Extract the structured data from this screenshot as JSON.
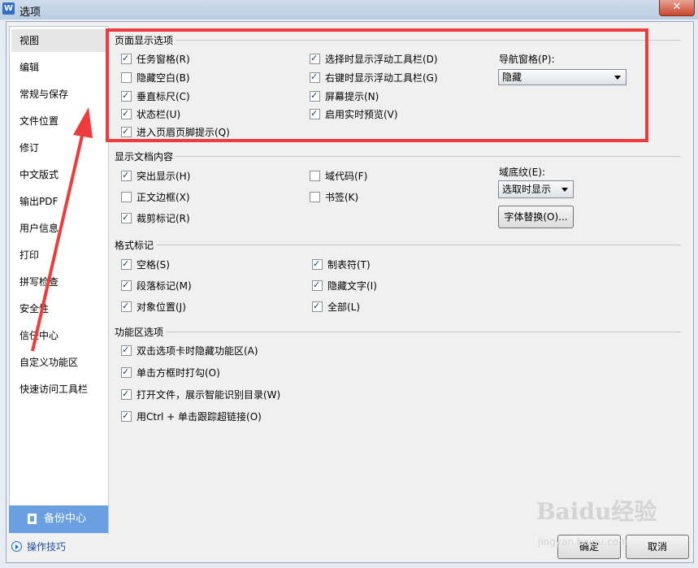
{
  "window": {
    "title": "选项",
    "app_icon": "W",
    "close_label": "✕"
  },
  "sidebar": {
    "items": [
      "视图",
      "编辑",
      "常规与保存",
      "文件位置",
      "修订",
      "中文版式",
      "输出PDF",
      "用户信息",
      "打印",
      "拼写检查",
      "安全性",
      "信任中心",
      "自定义功能区",
      "快速访问工具栏"
    ],
    "active_index": 0,
    "backup_label": "备份中心",
    "tips_label": "操作技巧"
  },
  "sections": {
    "page_display": {
      "title": "页面显示选项",
      "options": [
        {
          "label": "任务窗格(R)",
          "checked": true
        },
        {
          "label": "隐藏空白(B)",
          "checked": false
        },
        {
          "label": "垂直标尺(C)",
          "checked": true
        },
        {
          "label": "状态栏(U)",
          "checked": true
        },
        {
          "label": "进入页眉页脚提示(Q)",
          "checked": true
        },
        {
          "label": "选择时显示浮动工具栏(D)",
          "checked": true
        },
        {
          "label": "右键时显示浮动工具栏(G)",
          "checked": true
        },
        {
          "label": "屏幕提示(N)",
          "checked": true
        },
        {
          "label": "启用实时预览(V)",
          "checked": true
        }
      ],
      "nav_pane_label": "导航窗格(P):",
      "nav_pane_value": "隐藏"
    },
    "doc_content": {
      "title": "显示文档内容",
      "options": [
        {
          "label": "突出显示(H)",
          "checked": true
        },
        {
          "label": "正文边框(X)",
          "checked": false
        },
        {
          "label": "裁剪标记(R)",
          "checked": true
        },
        {
          "label": "域代码(F)",
          "checked": false
        },
        {
          "label": "书签(K)",
          "checked": false
        }
      ],
      "field_shading_label": "域底纹(E):",
      "field_shading_value": "选取时显示",
      "font_replace_button": "字体替换(O)..."
    },
    "format_marks": {
      "title": "格式标记",
      "options": [
        {
          "label": "空格(S)",
          "checked": true
        },
        {
          "label": "段落标记(M)",
          "checked": true
        },
        {
          "label": "对象位置(J)",
          "checked": true
        },
        {
          "label": "制表符(T)",
          "checked": true
        },
        {
          "label": "隐藏文字(I)",
          "checked": true
        },
        {
          "label": "全部(L)",
          "checked": true
        }
      ]
    },
    "ribbon": {
      "title": "功能区选项",
      "options": [
        {
          "label": "双击选项卡时隐藏功能区(A)",
          "checked": true
        },
        {
          "label": "单击方框时打勾(O)",
          "checked": true
        },
        {
          "label": "打开文件，展示智能识别目录(W)",
          "checked": true
        },
        {
          "label": "用Ctrl + 单击跟踪超链接(O)",
          "checked": true
        }
      ]
    }
  },
  "footer": {
    "ok_label": "确定",
    "cancel_label": "取消"
  },
  "watermark": {
    "line1": "Baidu经验",
    "line2": "jingyan.baidu.com"
  },
  "colors": {
    "annotation_red": "#ef3b3b",
    "sidebar_active": "#e6e6e6",
    "backup_blue": "#6aa0e2"
  }
}
